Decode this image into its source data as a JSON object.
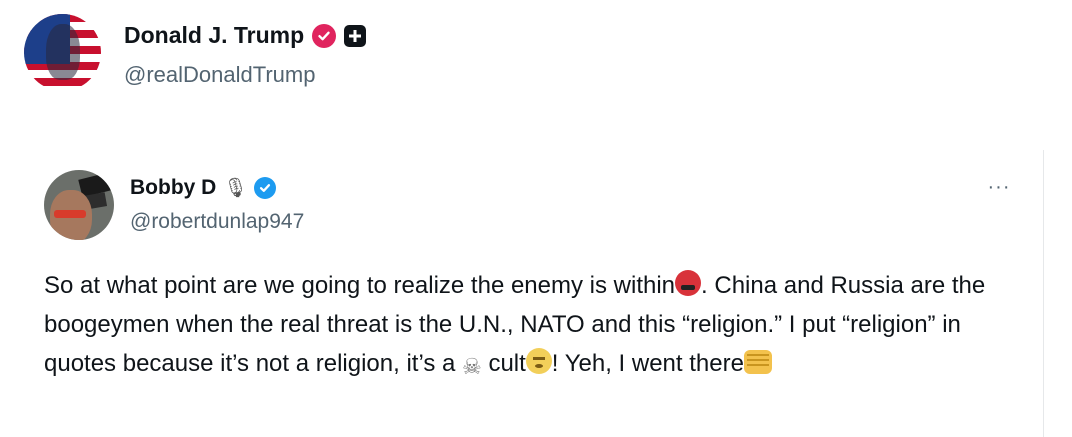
{
  "outer_post": {
    "display_name": "Donald J. Trump",
    "handle": "@realDonaldTrump",
    "verified_badge": "gold-verified-icon",
    "affiliate_badge": "plus-square-icon"
  },
  "quoted_post": {
    "display_name": "Bobby D",
    "name_icon": "microphone-icon",
    "verified_badge": "blue-verified-icon",
    "handle": "@robertdunlap947",
    "more_label": "···",
    "text": {
      "part1": "So at what point are we going to realize the enemy is within",
      "part2": ". China and Russia are the boogeymen when the real threat is the U.N., NATO and this “religion.” I put “religion” in quotes because it’s not a religion, it’s a ",
      "skull_emoji": "☠",
      "part3": " cult",
      "part4": "! Yeh, I went there"
    }
  },
  "colors": {
    "text_primary": "#0f1419",
    "text_secondary": "#536471",
    "verified_blue": "#1d9bf0"
  }
}
